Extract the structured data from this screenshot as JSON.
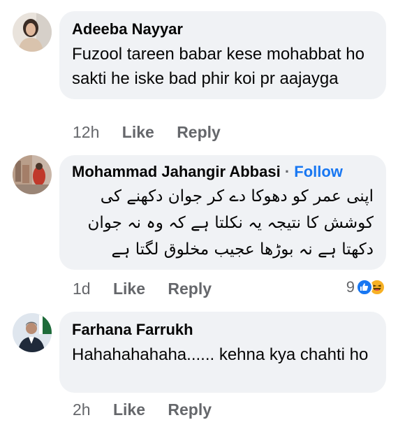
{
  "comments": [
    {
      "author": "Adeeba Nayyar",
      "text": "Fuzool tareen babar kese mohabbat ho sakti he iske bad phir koi pr aajayga",
      "time": "12h",
      "like_label": "Like",
      "reply_label": "Reply"
    },
    {
      "author": "Mohammad Jahangir Abbasi",
      "separator": "·",
      "follow_label": "Follow",
      "text": "اپنی عمر کو دھوکا دے کر جوان دکھنے کی کوشش کا نتیجہ یہ نکلتا ہے کہ وہ نہ جوان دکھتا ہے نہ بوڑھا عجیب مخلوق لگتا ہے",
      "time": "1d",
      "like_label": "Like",
      "reply_label": "Reply",
      "reaction_count": "9",
      "reaction_icons": [
        "like-icon",
        "haha-icon"
      ],
      "colors": {
        "like": "#1877f2",
        "haha": "#f7b125"
      }
    },
    {
      "author": "Farhana Farrukh",
      "text": "Hahahahahaha...... kehna kya chahti ho",
      "time": "2h",
      "like_label": "Like",
      "reply_label": "Reply"
    }
  ]
}
